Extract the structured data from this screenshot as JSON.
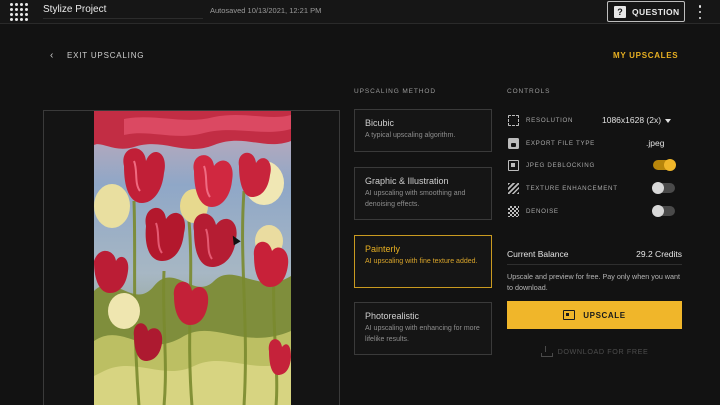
{
  "app": {
    "project_title": "Stylize Project",
    "autosave_text": "Autosaved 10/13/2021, 12:21 PM",
    "question_label": "QUESTION"
  },
  "nav": {
    "exit_label": "EXIT UPSCALING",
    "my_upscales_label": "MY UPSCALES"
  },
  "methods": {
    "header": "UPSCALING METHOD",
    "items": [
      {
        "title": "Bicubic",
        "desc": "A typical upscaling algorithm.",
        "selected": false
      },
      {
        "title": "Graphic & Illustration",
        "desc": "AI upscaling with smoothing and denoising effects.",
        "selected": false
      },
      {
        "title": "Painterly",
        "desc": "AI upscaling with fine texture added.",
        "selected": true
      },
      {
        "title": "Photorealistic",
        "desc": "AI upscaling with enhancing for more lifelike results.",
        "selected": false
      }
    ]
  },
  "controls": {
    "header": "CONTROLS",
    "resolution": {
      "label": "RESOLUTION",
      "value": "1086x1628 (2x)"
    },
    "file_type": {
      "label": "EXPORT FILE TYPE",
      "value": ".jpeg"
    },
    "jpeg_deblocking": {
      "label": "JPEG DEBLOCKING",
      "on": true
    },
    "texture_enhancement": {
      "label": "TEXTURE ENHANCEMENT",
      "on": false
    },
    "denoise": {
      "label": "DENOISE",
      "on": false
    }
  },
  "balance": {
    "label": "Current Balance",
    "value": "29.2 Credits",
    "note": "Upscale and preview for free. Pay only when you want to download."
  },
  "actions": {
    "upscale_label": "UPSCALE",
    "download_label": "DOWNLOAD FOR FREE"
  },
  "colors": {
    "accent": "#f0b62a",
    "background": "#121212"
  }
}
